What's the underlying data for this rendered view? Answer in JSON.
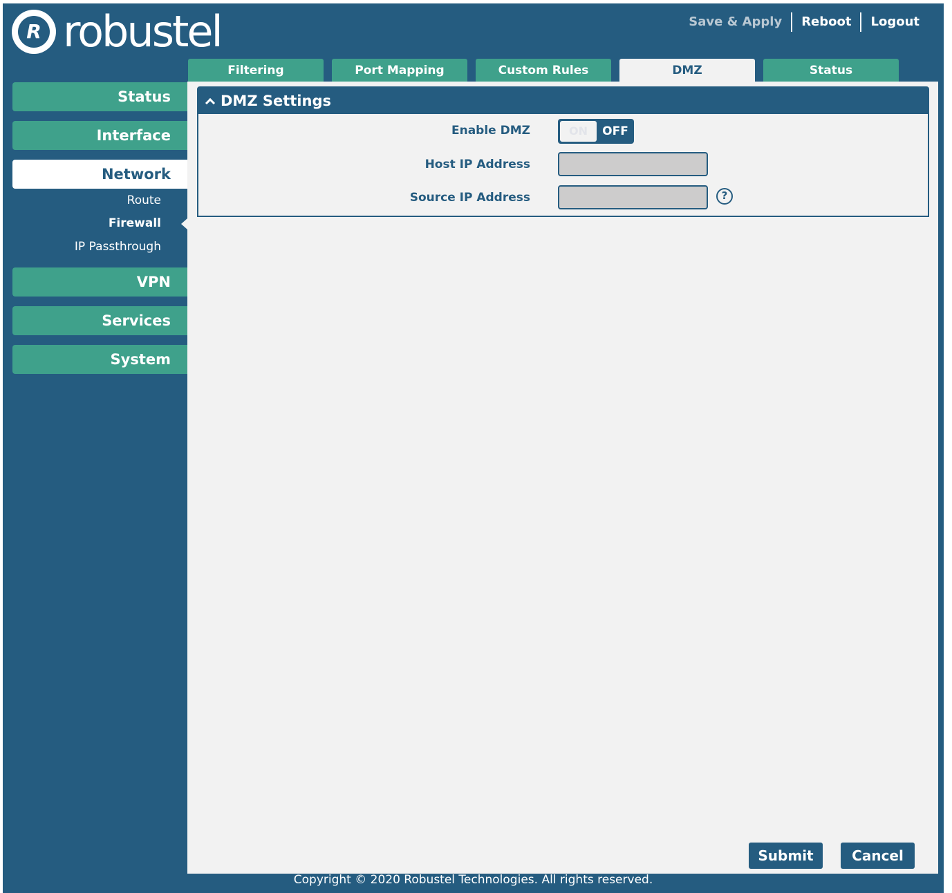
{
  "brand": {
    "logo_text": "robustel",
    "logo_mark": "R"
  },
  "header": {
    "save_apply": "Save & Apply",
    "reboot": "Reboot",
    "logout": "Logout"
  },
  "tabs": [
    {
      "label": "Filtering"
    },
    {
      "label": "Port Mapping"
    },
    {
      "label": "Custom Rules"
    },
    {
      "label": "DMZ",
      "active": true
    },
    {
      "label": "Status"
    }
  ],
  "sidebar": {
    "items": [
      {
        "label": "Status"
      },
      {
        "label": "Interface"
      },
      {
        "label": "Network",
        "active": true
      },
      {
        "label": "VPN"
      },
      {
        "label": "Services"
      },
      {
        "label": "System"
      }
    ],
    "subitems": [
      {
        "label": "Route"
      },
      {
        "label": "Firewall",
        "active": true
      },
      {
        "label": "IP Passthrough"
      }
    ]
  },
  "panel": {
    "title": "DMZ Settings",
    "enable_label": "Enable DMZ",
    "toggle": {
      "on_label": "ON",
      "off_label": "OFF",
      "state": "off"
    },
    "host_ip_label": "Host IP Address",
    "host_ip_value": "",
    "source_ip_label": "Source IP Address",
    "source_ip_value": "",
    "help_glyph": "?"
  },
  "actions": {
    "submit": "Submit",
    "cancel": "Cancel"
  },
  "footer": {
    "copyright": "Copyright © 2020 Robustel Technologies. All rights reserved."
  },
  "colors": {
    "primary": "#255c80",
    "accent": "#3fa18b",
    "content_bg": "#f2f2f2",
    "input_bg": "#cdcccc"
  },
  "icons": {
    "collapse": "chevron-up-icon",
    "help": "help-circle-icon"
  }
}
